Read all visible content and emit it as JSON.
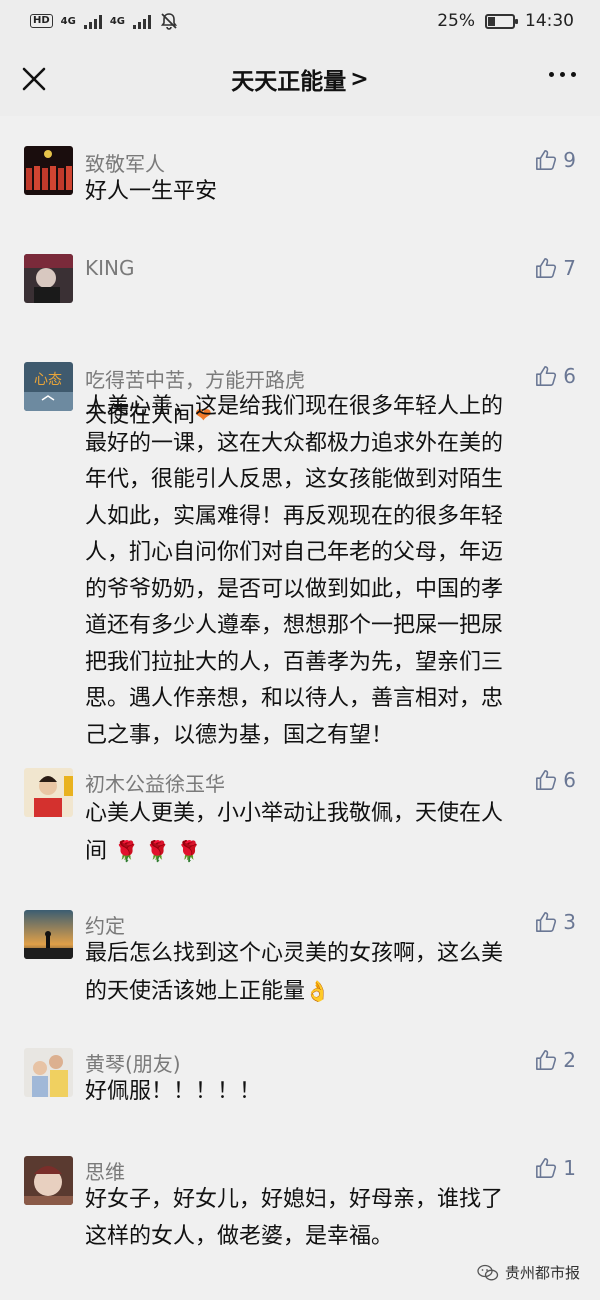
{
  "status_bar": {
    "hd": "HD",
    "net1": "4G",
    "net2": "4G",
    "battery_pct": "25%",
    "battery_level": 0.25,
    "time": "14:30",
    "icons": [
      "hd-icon",
      "signal-icon",
      "signal-icon",
      "mute-icon",
      "battery-icon"
    ]
  },
  "nav": {
    "title": "天天正能量",
    "chevron": ">",
    "close_icon": "close-icon",
    "more_icon": "more-icon"
  },
  "comments": [
    {
      "name": "致敬军人",
      "likes": "9",
      "lines": [
        "好人一生平安"
      ]
    },
    {
      "name": "KING",
      "likes": "7",
      "lines": [
        "天使在人间"
      ],
      "emoji": "❤"
    },
    {
      "name": "吃得苦中苦，方能开路虎",
      "likes": "6",
      "avatar_text": "心态",
      "lines": [
        "人美心善，这是给我们现在很多年轻人上的",
        "最好的一课，这在大众都极力追求外在美的",
        "年代，很能引人反思，这女孩能做到对陌生",
        "人如此，实属难得！再反观现在的很多年轻",
        "人，扪心自问你们对自己年老的父母，年迈",
        "的爷爷奶奶，是否可以做到如此，中国的孝",
        "道还有多少人遵奉，想想那个一把屎一把尿",
        "把我们拉扯大的人，百善孝为先，望亲们三",
        "思。遇人作亲想，和以待人，善言相对，忠",
        "己之事，以德为基，国之有望！"
      ]
    },
    {
      "name": "初木公益徐玉华",
      "likes": "6",
      "lines": [
        "心美人更美，小小举动让我敬佩，天使在人",
        "间"
      ],
      "emoji": "🌹 🌹 🌹"
    },
    {
      "name": "约定",
      "likes": "3",
      "lines": [
        "最后怎么找到这个心灵美的女孩啊，这么美",
        "的天使活该她上正能量"
      ],
      "emoji": "👌"
    },
    {
      "name": "黄琴(朋友)",
      "likes": "2",
      "lines": [
        "好佩服！！！！！"
      ]
    },
    {
      "name": "思维",
      "likes": "1",
      "lines": [
        "好女子，好女儿，好媳妇，好母亲，谁找了",
        "这样的女人，做老婆，是幸福。"
      ]
    }
  ],
  "watermark": {
    "text": "贵州都市报",
    "icon": "wechat-icon"
  },
  "colors": {
    "background": "#ededed",
    "comment_bg": "#f0f0f0",
    "name": "#7a7a7a",
    "like": "#6a7794"
  }
}
